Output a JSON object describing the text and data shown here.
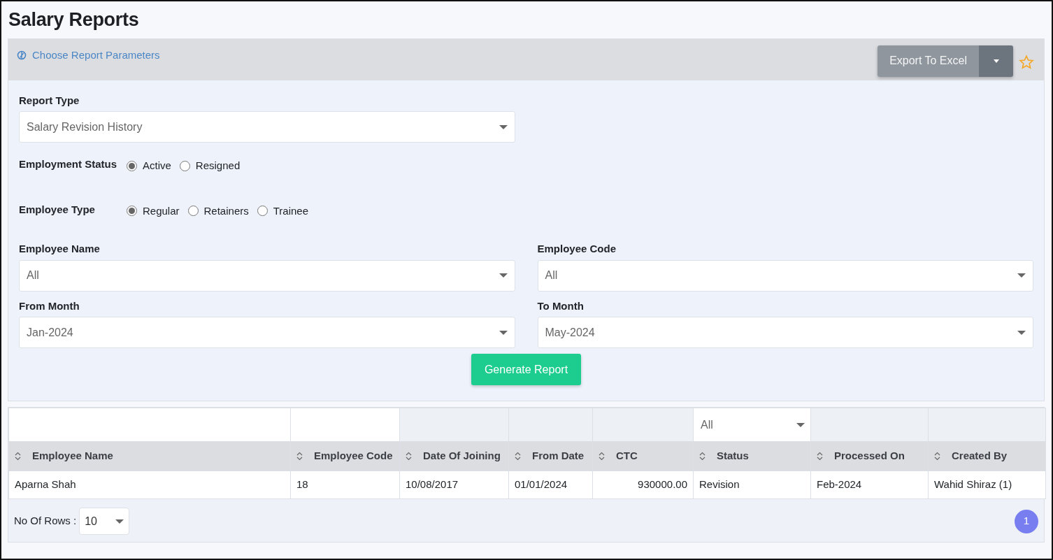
{
  "page_title": "Salary Reports",
  "panel": {
    "header_link": "Choose Report Parameters",
    "export_button": "Export To Excel",
    "favorite": false
  },
  "report_type": {
    "label": "Report Type",
    "value": "Salary Revision History"
  },
  "radio_groups": [
    {
      "label": "Employment Status",
      "options": [
        {
          "label": "Active",
          "selected": true
        },
        {
          "label": "Resigned",
          "selected": false
        }
      ]
    },
    {
      "label": "Employee Type",
      "options": [
        {
          "label": "Regular",
          "selected": true
        },
        {
          "label": "Retainers",
          "selected": false
        },
        {
          "label": "Trainee",
          "selected": false
        }
      ]
    }
  ],
  "selects": [
    {
      "label": "Employee Name",
      "value": "All"
    },
    {
      "label": "Employee Code",
      "value": "All"
    },
    {
      "label": "From Month",
      "value": "Jan-2024"
    },
    {
      "label": "To Month",
      "value": "May-2024"
    }
  ],
  "generate_button": "Generate Report",
  "table": {
    "filters": [
      {
        "kind": "field"
      },
      {
        "kind": "field"
      },
      {
        "kind": "none"
      },
      {
        "kind": "none"
      },
      {
        "kind": "none"
      },
      {
        "kind": "select",
        "value": "All"
      },
      {
        "kind": "none"
      },
      {
        "kind": "none"
      }
    ],
    "columns": [
      {
        "label": "Employee Name",
        "kind": "text"
      },
      {
        "label": "Employee Code",
        "kind": "text"
      },
      {
        "label": "Date Of Joining",
        "kind": "text"
      },
      {
        "label": "From Date",
        "kind": "text"
      },
      {
        "label": "CTC",
        "kind": "number"
      },
      {
        "label": "Status",
        "kind": "text"
      },
      {
        "label": "Processed On",
        "kind": "text"
      },
      {
        "label": "Created By",
        "kind": "text"
      }
    ],
    "rows": [
      [
        "Aparna Shah",
        "18",
        "10/08/2017",
        "01/01/2024",
        "930000.00",
        "Revision",
        "Feb-2024",
        "Wahid Shiraz (1)"
      ]
    ]
  },
  "footer": {
    "rows_label": "No Of Rows :",
    "rows_value": "10",
    "pages": [
      {
        "label": "1",
        "selected": true
      }
    ]
  }
}
